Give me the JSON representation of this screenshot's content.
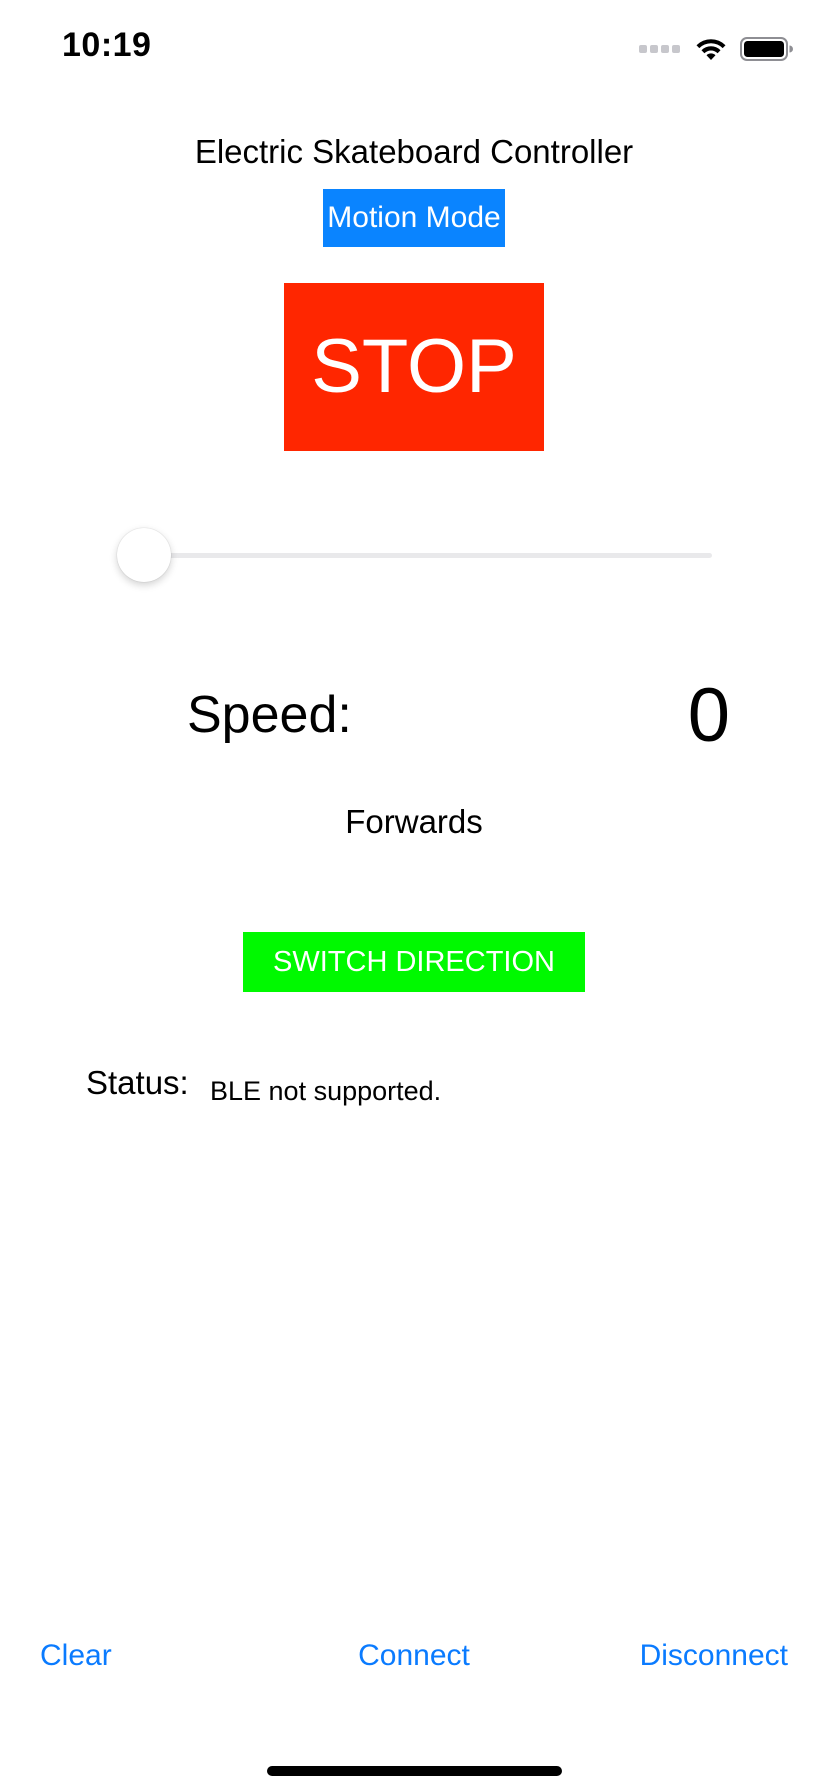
{
  "status_bar": {
    "time": "10:19",
    "icons": [
      "signal-icon",
      "wifi-icon",
      "battery-icon"
    ]
  },
  "app": {
    "title": "Electric Skateboard Controller",
    "motion_mode_label": "Motion Mode",
    "stop_label": "STOP",
    "slider_value": 0,
    "speed_label": "Speed:",
    "speed_value": "0",
    "direction": "Forwards",
    "switch_direction_label": "SWITCH DIRECTION",
    "status_label": "Status:",
    "status_value": "BLE not supported."
  },
  "bottom_bar": {
    "clear_label": "Clear",
    "connect_label": "Connect",
    "disconnect_label": "Disconnect"
  },
  "colors": {
    "motion_mode": "#0a84ff",
    "stop": "#ff2600",
    "switch_direction": "#00f900",
    "link": "#0a7bff"
  }
}
